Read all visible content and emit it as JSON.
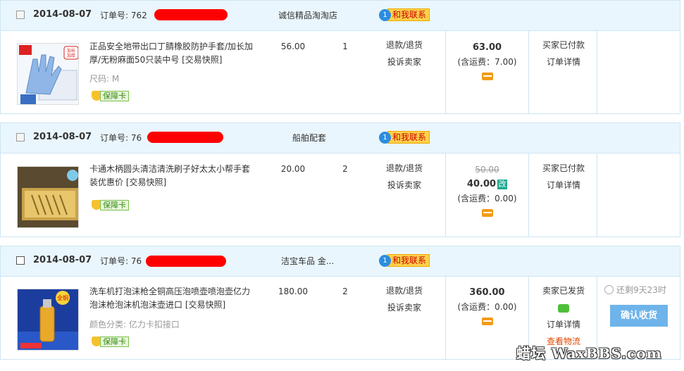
{
  "orders": [
    {
      "date": "2014-08-07",
      "order_label": "订单号:",
      "order_no_prefix": "762",
      "shop": "诚信精品淘淘店",
      "contact_label": "和我联系",
      "item": {
        "title": "正品安全地带出口丁腈橡胶防护手套/加长加厚/无粉麻面50只装中号 [交易快照]",
        "sku": "尺码: M",
        "guarantee": "保障卡",
        "price": "56.00",
        "qty": "1",
        "service": [
          "退款/退货",
          "投诉卖家"
        ],
        "total": "63.00",
        "shipping": "(含运费：7.00)",
        "status": [
          "买家已付款",
          "订单详情"
        ],
        "thumb_text": [
          "加长",
          "加厚"
        ]
      }
    },
    {
      "date": "2014-08-07",
      "order_label": "订单号:",
      "order_no_prefix": "76",
      "shop": "船舶配套",
      "contact_label": "和我联系",
      "item": {
        "title": "卡通木柄圆头清洁清洗刷子好太太小帮手套装优惠价 [交易快照]",
        "guarantee": "保障卡",
        "price": "20.00",
        "qty": "2",
        "service": [
          "退款/退货",
          "投诉卖家"
        ],
        "original_total": "50.00",
        "total": "40.00",
        "modified_badge": "改",
        "shipping": "(含运费：0.00)",
        "status": [
          "买家已付款",
          "订单详情"
        ]
      }
    },
    {
      "date": "2014-08-07",
      "order_label": "订单号:",
      "order_no_prefix": "76",
      "shop": "洁宝车品 金...",
      "contact_label": "和我联系",
      "item": {
        "title": "洗车机打泡沫枪全铜高压泡喷壶喷泡壶亿力泡沫枪泡沫机泡沫壶进口 [交易快照]",
        "sku": "颜色分类: 亿力卡扣接口",
        "guarantee": "保障卡",
        "price": "180.00",
        "qty": "2",
        "service": [
          "退款/退货",
          "投诉卖家"
        ],
        "total": "360.00",
        "shipping": "(含运费：0.00)",
        "status": [
          "卖家已发货",
          "订单详情",
          "查看物流"
        ],
        "thumb_text": [
          "全铜"
        ],
        "countdown": "还剩9天23时",
        "confirm_label": "确认收货"
      }
    }
  ],
  "watermark": "蜡坛 WaxBBS.com",
  "colors": {
    "header_bg": "#eaf6fd",
    "border": "#cde5f3",
    "confirm_bg": "#6eb4ea",
    "redact": "#ff0000",
    "logistics": "#e04a00"
  }
}
